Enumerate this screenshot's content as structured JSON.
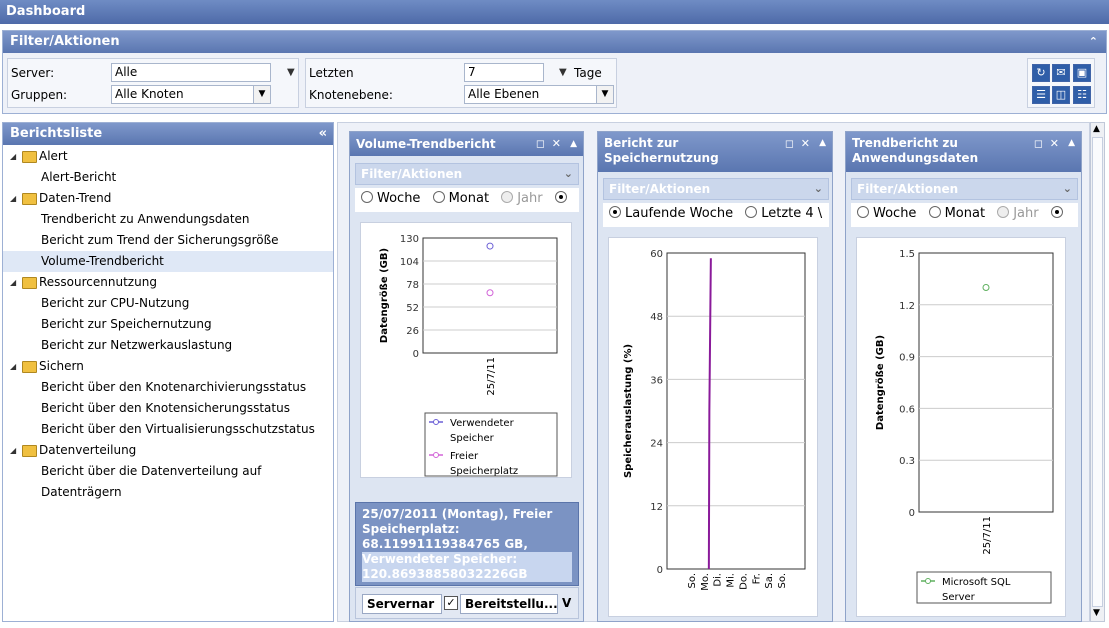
{
  "title": "Dashboard",
  "filter": {
    "header": "Filter/Aktionen",
    "server_label": "Server:",
    "server_value": "Alle",
    "groups_label": "Gruppen:",
    "groups_value": "Alle Knoten",
    "last_label": "Letzten",
    "last_value": "7",
    "unit_value": "Tage",
    "node_level_label": "Knotenebene:",
    "node_level_value": "Alle Ebenen"
  },
  "report_list": {
    "header": "Berichtsliste",
    "items": [
      {
        "label": "Alert",
        "level": 0
      },
      {
        "label": "Alert-Bericht",
        "level": 1
      },
      {
        "label": "Daten-Trend",
        "level": 0
      },
      {
        "label": "Trendbericht zu Anwendungsdaten",
        "level": 1
      },
      {
        "label": "Bericht zum Trend der Sicherungsgröße",
        "level": 1
      },
      {
        "label": "Volume-Trendbericht",
        "level": 1,
        "selected": true
      },
      {
        "label": "Ressourcennutzung",
        "level": 0
      },
      {
        "label": "Bericht zur CPU-Nutzung",
        "level": 1
      },
      {
        "label": "Bericht zur Speichernutzung",
        "level": 1
      },
      {
        "label": "Bericht zur Netzwerkauslastung",
        "level": 1
      },
      {
        "label": "Sichern",
        "level": 0
      },
      {
        "label": "Bericht über den Knotenarchivierungsstatus",
        "level": 1
      },
      {
        "label": "Bericht über den Knotensicherungsstatus",
        "level": 1
      },
      {
        "label": "Bericht über den Virtualisierungsschutzstatus",
        "level": 1
      },
      {
        "label": "Datenverteilung",
        "level": 0
      },
      {
        "label": "Bericht über die Datenverteilung auf Datenträgern",
        "level": 1
      }
    ]
  },
  "cards": [
    {
      "title": "Volume-Trendbericht",
      "filter_header": "Filter/Aktionen",
      "radios": [
        "Woche",
        "Monat",
        "Jahr"
      ],
      "tooltip_a": "25/07/2011 (Montag), Freier Speicherplatz: 68.11991119384765 GB,",
      "tooltip_b": "Verwendeter Speicher: 120.86938858032226GB",
      "buttons": [
        "Servernar",
        "Bereitstellu...",
        "V"
      ]
    },
    {
      "title": "Bericht zur Speichernutzung",
      "filter_header": "Filter/Aktionen",
      "radios": [
        "Laufende Woche",
        "Letzte 4 \\"
      ]
    },
    {
      "title": "Trendbericht zu Anwendungsdaten",
      "filter_header": "Filter/Aktionen",
      "radios": [
        "Woche",
        "Monat",
        "Jahr"
      ]
    }
  ],
  "colors": {
    "used": "#6b5fd6",
    "free": "#d264d8",
    "sql": "#5fb05f",
    "cpu_line": "#8a1a9a"
  },
  "chart_data": [
    {
      "type": "scatter",
      "title": "",
      "xlabel": "",
      "ylabel": "Datengröße (GB)",
      "categories": [
        "25/7/11"
      ],
      "ylim": [
        0,
        130
      ],
      "yticks": [
        0,
        26,
        52,
        78,
        104,
        130
      ],
      "series": [
        {
          "name": "Verwendeter Speicher",
          "values": [
            120.87
          ]
        },
        {
          "name": "Freier Speicherplatz",
          "values": [
            68.12
          ]
        }
      ],
      "legend": "bottom"
    },
    {
      "type": "line",
      "title": "",
      "xlabel": "",
      "ylabel": "Speicherauslastung (%)",
      "categories": [
        "So.",
        "Mo.",
        "Di.",
        "Mi.",
        "Do.",
        "Fr.",
        "Sa.",
        "So."
      ],
      "ylim": [
        0,
        60
      ],
      "yticks": [
        0,
        12,
        24,
        36,
        48,
        60
      ],
      "series": [
        {
          "values": [
            0,
            59
          ]
        }
      ]
    },
    {
      "type": "scatter",
      "title": "",
      "xlabel": "",
      "ylabel": "Datengröße (GB)",
      "categories": [
        "25/7/11"
      ],
      "ylim": [
        0,
        1.5
      ],
      "yticks": [
        "0",
        "0.3",
        "0.6",
        "0.9",
        "1.2",
        "1.5"
      ],
      "series": [
        {
          "name": "Microsoft SQL Server",
          "values": [
            1.3
          ]
        }
      ],
      "legend": "bottom"
    }
  ]
}
